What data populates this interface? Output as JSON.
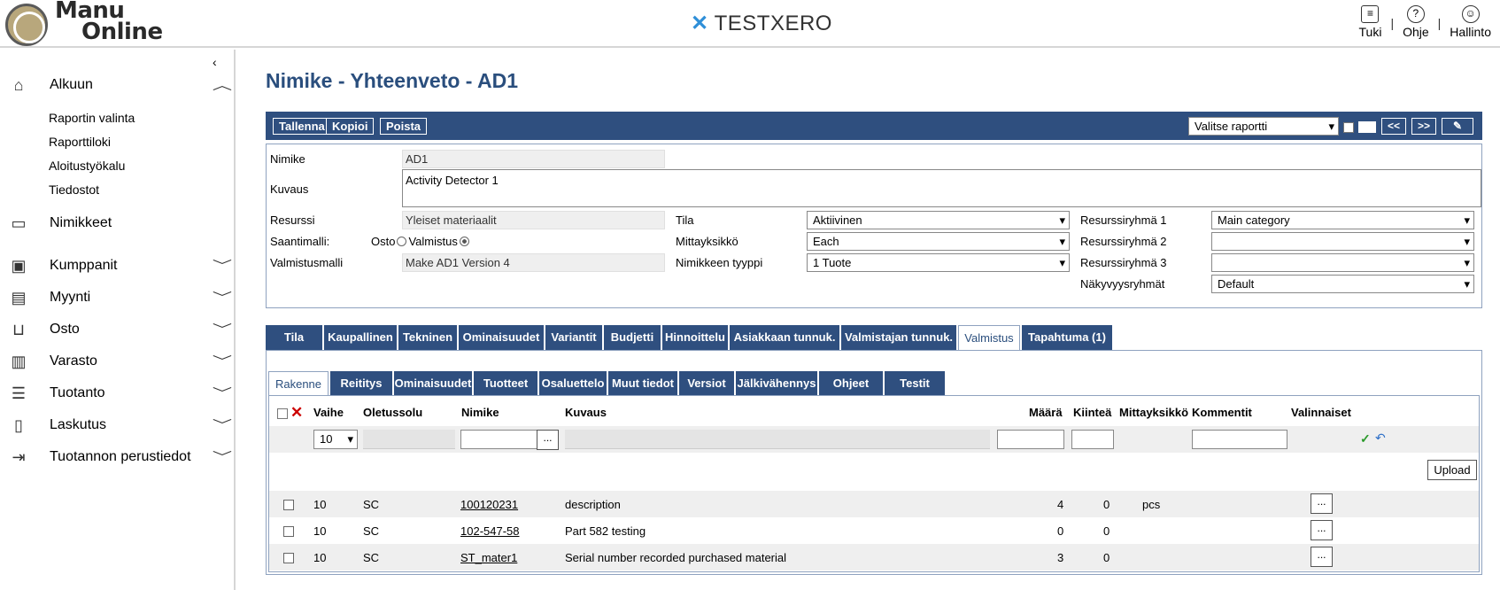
{
  "header": {
    "logo_line1": "Manu",
    "logo_line2": "Online",
    "brand": "TESTXERO",
    "links": [
      {
        "label": "Tuki",
        "icon": "chat-icon"
      },
      {
        "label": "Ohje",
        "icon": "help-icon"
      },
      {
        "label": "Hallinto",
        "icon": "user-icon"
      }
    ],
    "separator": "|"
  },
  "sidebar": {
    "collapse_glyph": "‹",
    "alkuun": "Alkuun",
    "alkuun_sub": [
      "Raportin valinta",
      "Raporttiloki",
      "Aloitustyökalu",
      "Tiedostot"
    ],
    "items": [
      "Nimikkeet",
      "Kumppanit",
      "Myynti",
      "Osto",
      "Varasto",
      "Tuotanto",
      "Laskutus",
      "Tuotannon perustiedot"
    ]
  },
  "page": {
    "title": "Nimike - Yhteenveto - AD1"
  },
  "toolbar": {
    "save": "Tallenna",
    "copy": "Kopioi",
    "delete": "Poista",
    "report_select": "Valitse raportti",
    "prev": "<<",
    "next": ">>",
    "attach": "✎"
  },
  "form": {
    "nimike_label": "Nimike",
    "nimike_value": "AD1",
    "kuvaus_label": "Kuvaus",
    "kuvaus_value": "Activity Detector 1",
    "resurssi_label": "Resurssi",
    "resurssi_value": "Yleiset materiaalit",
    "saantimalli_label": "Saantimalli:",
    "osto_label": "Osto",
    "valmistus_label": "Valmistus",
    "valmistusmalli_label": "Valmistusmalli",
    "valmistusmalli_value": "Make AD1 Version 4",
    "tila_label": "Tila",
    "tila_value": "Aktiivinen",
    "mittayksikko_label": "Mittayksikkö",
    "mittayksikko_value": "Each",
    "tyyppi_label": "Nimikkeen tyyppi",
    "tyyppi_value": "1 Tuote",
    "rr1_label": "Resurssiryhmä 1",
    "rr1_value": "Main category",
    "rr2_label": "Resurssiryhmä 2",
    "rr2_value": "",
    "rr3_label": "Resurssiryhmä 3",
    "rr3_value": "",
    "nakyvyys_label": "Näkyvyysryhmät",
    "nakyvyys_value": "Default"
  },
  "tabs": [
    "Tila",
    "Kaupallinen",
    "Tekninen",
    "Ominaisuudet",
    "Variantit",
    "Budjetti",
    "Hinnoittelu",
    "Asiakkaan tunnuk.",
    "Valmistajan tunnuk.",
    "Valmistus",
    "Tapahtuma (1)"
  ],
  "subtabs": [
    "Rakenne",
    "Reititys",
    "Ominaisuudet",
    "Tuotteet",
    "Osaluettelo",
    "Muut tiedot",
    "Versiot",
    "Jälkivähennys",
    "Ohjeet",
    "Testit"
  ],
  "grid": {
    "headers": {
      "vaihe": "Vaihe",
      "oletussolu": "Oletussolu",
      "nimike": "Nimike",
      "kuvaus": "Kuvaus",
      "maara": "Määrä",
      "kiintea": "Kiinteä",
      "mittayksikko": "Mittayksikkö",
      "kommentit": "Kommentit",
      "valinnaiset": "Valinnaiset"
    },
    "vaihe_select": "10",
    "lookup": "...",
    "upload": "Upload",
    "rows": [
      {
        "vaihe": "10",
        "solu": "SC",
        "nimike": "100120231",
        "kuvaus": "description",
        "maara": "4",
        "kiintea": "0",
        "yksikko": "pcs"
      },
      {
        "vaihe": "10",
        "solu": "SC",
        "nimike": "102-547-58",
        "kuvaus": "Part 582 testing",
        "maara": "0",
        "kiintea": "0",
        "yksikko": ""
      },
      {
        "vaihe": "10",
        "solu": "SC",
        "nimike": "ST_mater1",
        "kuvaus": "Serial number recorded purchased material",
        "maara": "3",
        "kiintea": "0",
        "yksikko": ""
      }
    ]
  }
}
